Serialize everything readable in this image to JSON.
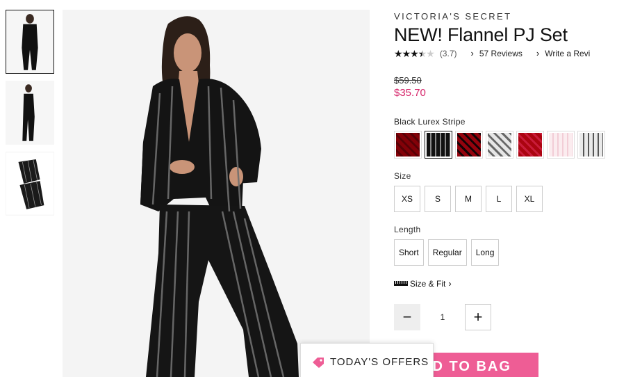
{
  "brand": "VICTORIA'S SECRET",
  "product": {
    "title": "NEW! Flannel PJ Set",
    "rating": 3.7,
    "rating_text": "(3.7)",
    "reviews_link": "57 Reviews",
    "write_review_link": "Write a Revi",
    "price_original": "$59.50",
    "price_sale": "$35.70"
  },
  "color": {
    "selected_label": "Black Lurex Stripe",
    "swatches": [
      {
        "name": "red-plaid",
        "colors": [
          "#b7122e",
          "#7a0a1f"
        ]
      },
      {
        "name": "black-lurex-stripe",
        "colors": [
          "#111111",
          "#8a8a8a"
        ]
      },
      {
        "name": "red-black-plaid",
        "colors": [
          "#c21a3a",
          "#1a1a1a"
        ]
      },
      {
        "name": "grey-white-plaid",
        "colors": [
          "#f2f2f2",
          "#6e6e6e"
        ]
      },
      {
        "name": "red-white-plaid",
        "colors": [
          "#d11f3f",
          "#f5e8ea"
        ]
      },
      {
        "name": "pink-stripe",
        "colors": [
          "#fbecef",
          "#f2cdd6"
        ]
      },
      {
        "name": "grey-stripe",
        "colors": [
          "#e9e9e9",
          "#555555"
        ]
      }
    ]
  },
  "size": {
    "label": "Size",
    "options": [
      "XS",
      "S",
      "M",
      "L",
      "XL"
    ]
  },
  "length": {
    "label": "Length",
    "options": [
      "Short",
      "Regular",
      "Long"
    ]
  },
  "fit_link": "Size & Fit",
  "quantity": {
    "value": "1",
    "minus": "−",
    "plus": "+"
  },
  "add_to_bag": "DD TO BAG",
  "offers": "TODAY'S OFFERS",
  "accent_color": "#ee5d95",
  "sale_color": "#d6256a"
}
